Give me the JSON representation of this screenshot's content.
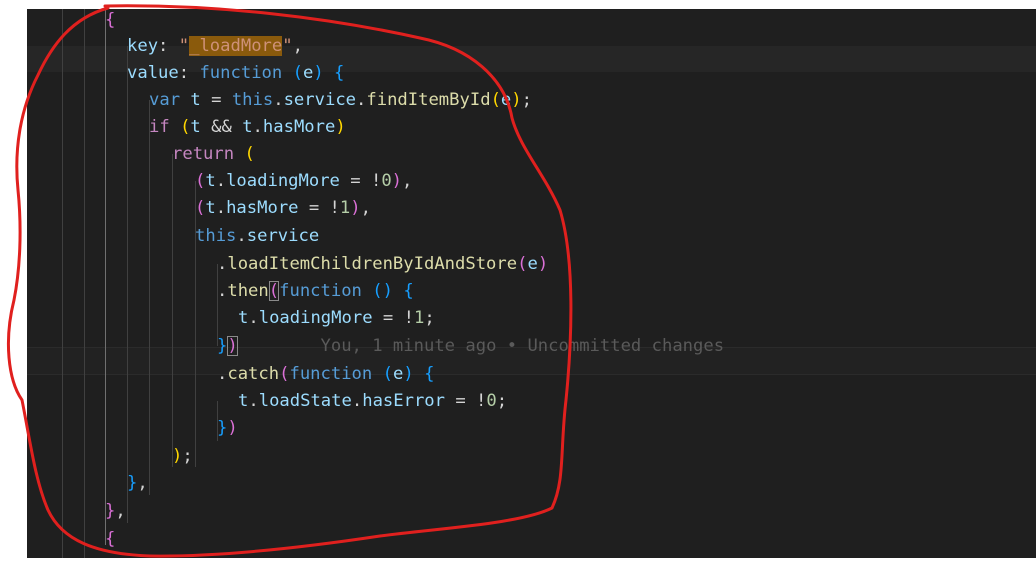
{
  "editor": {
    "lines": [
      {
        "tokens": [
          {
            "t": "{",
            "c": "p"
          }
        ]
      },
      {
        "tokens": [
          {
            "t": "key",
            "c": "prop"
          },
          {
            "t": ": ",
            "c": "op"
          },
          {
            "t": "\"",
            "c": "str"
          },
          {
            "t": "_loadMore",
            "c": "str match"
          },
          {
            "t": "\"",
            "c": "str"
          },
          {
            "t": ",",
            "c": "op"
          }
        ]
      },
      {
        "tokens": [
          {
            "t": "value",
            "c": "prop"
          },
          {
            "t": ": ",
            "c": "op"
          },
          {
            "t": "function",
            "c": "kw"
          },
          {
            "t": " ",
            "c": "op"
          },
          {
            "t": "(",
            "c": "b"
          },
          {
            "t": "e",
            "c": "prop"
          },
          {
            "t": ")",
            "c": "b"
          },
          {
            "t": " ",
            "c": "op"
          },
          {
            "t": "{",
            "c": "b"
          }
        ]
      },
      {
        "tokens": [
          {
            "t": "var",
            "c": "kw"
          },
          {
            "t": " ",
            "c": "op"
          },
          {
            "t": "t",
            "c": "prop"
          },
          {
            "t": " = ",
            "c": "op"
          },
          {
            "t": "this",
            "c": "kw"
          },
          {
            "t": ".",
            "c": "op"
          },
          {
            "t": "service",
            "c": "prop"
          },
          {
            "t": ".",
            "c": "op"
          },
          {
            "t": "findItemById",
            "c": "fn"
          },
          {
            "t": "(",
            "c": "y"
          },
          {
            "t": "e",
            "c": "prop"
          },
          {
            "t": ")",
            "c": "y"
          },
          {
            "t": ";",
            "c": "op"
          }
        ]
      },
      {
        "tokens": [
          {
            "t": "if",
            "c": "ctl"
          },
          {
            "t": " ",
            "c": "op"
          },
          {
            "t": "(",
            "c": "y"
          },
          {
            "t": "t",
            "c": "prop"
          },
          {
            "t": " && ",
            "c": "op"
          },
          {
            "t": "t",
            "c": "prop"
          },
          {
            "t": ".",
            "c": "op"
          },
          {
            "t": "hasMore",
            "c": "prop"
          },
          {
            "t": ")",
            "c": "y"
          }
        ]
      },
      {
        "tokens": [
          {
            "t": "return",
            "c": "ctl"
          },
          {
            "t": " ",
            "c": "op"
          },
          {
            "t": "(",
            "c": "y"
          }
        ]
      },
      {
        "tokens": [
          {
            "t": "(",
            "c": "p"
          },
          {
            "t": "t",
            "c": "prop"
          },
          {
            "t": ".",
            "c": "op"
          },
          {
            "t": "loadingMore",
            "c": "prop"
          },
          {
            "t": " = !",
            "c": "op"
          },
          {
            "t": "0",
            "c": "num"
          },
          {
            "t": ")",
            "c": "p"
          },
          {
            "t": ",",
            "c": "op"
          }
        ]
      },
      {
        "tokens": [
          {
            "t": "(",
            "c": "p"
          },
          {
            "t": "t",
            "c": "prop"
          },
          {
            "t": ".",
            "c": "op"
          },
          {
            "t": "hasMore",
            "c": "prop"
          },
          {
            "t": " = !",
            "c": "op"
          },
          {
            "t": "1",
            "c": "num"
          },
          {
            "t": ")",
            "c": "p"
          },
          {
            "t": ",",
            "c": "op"
          }
        ]
      },
      {
        "tokens": [
          {
            "t": "this",
            "c": "kw"
          },
          {
            "t": ".",
            "c": "op"
          },
          {
            "t": "service",
            "c": "prop"
          }
        ]
      },
      {
        "tokens": [
          {
            "t": ".",
            "c": "op"
          },
          {
            "t": "loadItemChildrenByIdAndStore",
            "c": "fn"
          },
          {
            "t": "(",
            "c": "p"
          },
          {
            "t": "e",
            "c": "prop"
          },
          {
            "t": ")",
            "c": "p"
          }
        ]
      },
      {
        "tokens": [
          {
            "t": ".",
            "c": "op"
          },
          {
            "t": "then",
            "c": "fn"
          },
          {
            "t": "(",
            "c": "p bracket-box"
          },
          {
            "t": "function",
            "c": "kw"
          },
          {
            "t": " ",
            "c": "op"
          },
          {
            "t": "()",
            "c": "b"
          },
          {
            "t": " ",
            "c": "op"
          },
          {
            "t": "{",
            "c": "b"
          }
        ]
      },
      {
        "tokens": [
          {
            "t": "t",
            "c": "prop"
          },
          {
            "t": ".",
            "c": "op"
          },
          {
            "t": "loadingMore",
            "c": "prop"
          },
          {
            "t": " = !",
            "c": "op"
          },
          {
            "t": "1",
            "c": "num"
          },
          {
            "t": ";",
            "c": "op"
          }
        ]
      },
      {
        "tokens": [
          {
            "t": "}",
            "c": "b"
          },
          {
            "t": ")",
            "c": "p bracket-box"
          },
          {
            "t": "        You, 1 minute ago • Uncommitted changes",
            "c": "blame"
          }
        ]
      },
      {
        "tokens": [
          {
            "t": ".",
            "c": "op"
          },
          {
            "t": "catch",
            "c": "fn"
          },
          {
            "t": "(",
            "c": "p"
          },
          {
            "t": "function",
            "c": "kw"
          },
          {
            "t": " ",
            "c": "op"
          },
          {
            "t": "(",
            "c": "b"
          },
          {
            "t": "e",
            "c": "prop"
          },
          {
            "t": ")",
            "c": "b"
          },
          {
            "t": " ",
            "c": "op"
          },
          {
            "t": "{",
            "c": "b"
          }
        ]
      },
      {
        "tokens": [
          {
            "t": "t",
            "c": "prop"
          },
          {
            "t": ".",
            "c": "op"
          },
          {
            "t": "loadState",
            "c": "prop"
          },
          {
            "t": ".",
            "c": "op"
          },
          {
            "t": "hasError",
            "c": "prop"
          },
          {
            "t": " = !",
            "c": "op"
          },
          {
            "t": "0",
            "c": "num"
          },
          {
            "t": ";",
            "c": "op"
          }
        ]
      },
      {
        "tokens": [
          {
            "t": "}",
            "c": "b"
          },
          {
            "t": ")",
            "c": "p"
          }
        ]
      },
      {
        "tokens": [
          {
            "t": ")",
            "c": "y"
          },
          {
            "t": ";",
            "c": "op"
          }
        ]
      },
      {
        "tokens": [
          {
            "t": "}",
            "c": "b"
          },
          {
            "t": ",",
            "c": "op"
          }
        ]
      },
      {
        "tokens": [
          {
            "t": "}",
            "c": "p"
          },
          {
            "t": ",",
            "c": "op"
          }
        ]
      },
      {
        "tokens": [
          {
            "t": "{",
            "c": "p"
          }
        ]
      }
    ],
    "colors": {
      "background": "#1f1f1f",
      "annotation": "#e0201e",
      "find_match": "#8a5a0c"
    }
  },
  "annotation": {
    "shape": "hand-drawn-ellipse",
    "color": "#e0201e"
  }
}
